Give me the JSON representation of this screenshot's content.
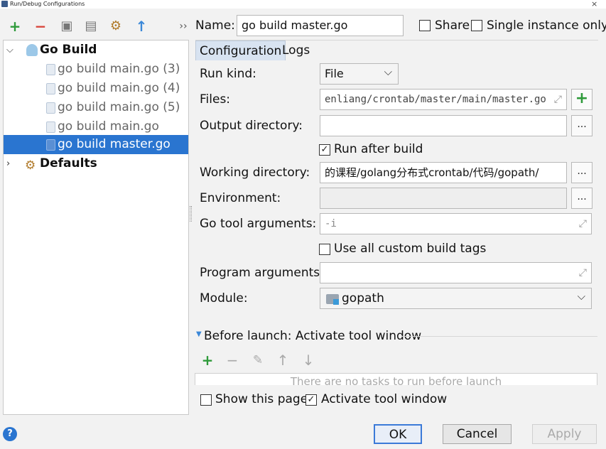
{
  "window": {
    "title": "Run/Debug Configurations",
    "close_glyph": "×"
  },
  "toolbar": {
    "add_glyph": "+",
    "remove_glyph": "−",
    "copy_glyph": "▣",
    "save_glyph": "▤",
    "wrench_glyph": "⚙",
    "move_up_glyph": "↑",
    "more_glyph": "››"
  },
  "tree": {
    "group": "Go Build",
    "items": [
      "go build main.go (3)",
      "go build main.go (4)",
      "go build main.go (5)",
      "go build main.go",
      "go build master.go"
    ],
    "defaults": "Defaults"
  },
  "header": {
    "name_label": "Name:",
    "name_value": "go build master.go",
    "share_label": "Share",
    "single_instance_label": "Single instance only"
  },
  "tabs": [
    "Configuration",
    "Logs"
  ],
  "form": {
    "run_kind_label": "Run kind:",
    "run_kind_value": "File",
    "files_label": "Files:",
    "files_value": "enliang/crontab/master/main/master.go",
    "output_dir_label": "Output directory:",
    "output_dir_value": "",
    "run_after_build_label": "Run after build",
    "working_dir_label": "Working directory:",
    "working_dir_value": "的课程/golang分布式crontab/代码/gopath/",
    "environment_label": "Environment:",
    "environment_value": "",
    "go_tool_args_label": "Go tool arguments:",
    "go_tool_args_value": "-i",
    "use_custom_tags_label": "Use all custom build tags",
    "program_args_label": "Program arguments:",
    "program_args_value": "",
    "module_label": "Module:",
    "module_value": "gopath",
    "browse_glyph": "...",
    "expand_glyph": "⤢",
    "dropdown_glyph": "⌵",
    "check_glyph": "✓"
  },
  "before_launch": {
    "title": "Before launch: Activate tool window",
    "add_glyph": "+",
    "remove_glyph": "−",
    "edit_glyph": "✎",
    "up_glyph": "↑",
    "down_glyph": "↓",
    "empty_text": "There are no tasks to run before launch"
  },
  "footer": {
    "show_page_label": "Show this page",
    "activate_tool_label": "Activate tool window",
    "help_glyph": "?",
    "ok": "OK",
    "cancel": "Cancel",
    "apply": "Apply"
  },
  "colors": {
    "accent": "#2a75d0",
    "green": "#2e9a3a",
    "red": "#d9443a",
    "blue": "#3b88d8"
  }
}
